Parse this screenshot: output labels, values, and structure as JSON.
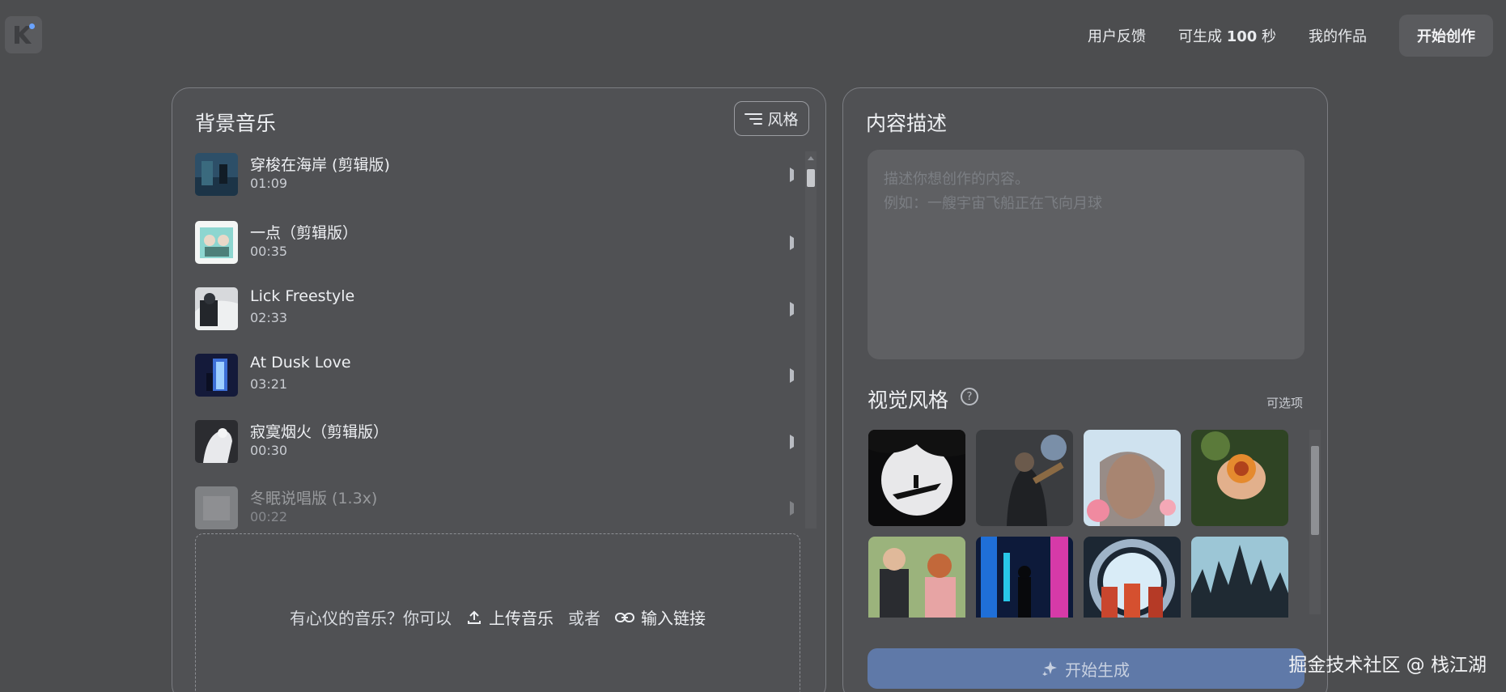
{
  "header": {
    "nav": {
      "feedback": "用户反馈",
      "credits_prefix": "可生成",
      "credits_value": "100",
      "credits_suffix": "秒",
      "my_works": "我的作品",
      "start": "开始创作"
    }
  },
  "music": {
    "title": "背景音乐",
    "style_button": "风格",
    "tracks": [
      {
        "title": "穿梭在海岸 (剪辑版)",
        "duration": "01:09"
      },
      {
        "title": "一点（剪辑版）",
        "duration": "00:35"
      },
      {
        "title": "Lick Freestyle",
        "duration": "02:33"
      },
      {
        "title": "At Dusk Love",
        "duration": "03:21"
      },
      {
        "title": "寂寞烟火（剪辑版）",
        "duration": "00:30"
      },
      {
        "title": "冬眠说唱版 (1.3x)",
        "duration": "00:22"
      }
    ],
    "upload": {
      "prompt": "有心仪的音乐？你可以",
      "upload_label": "上传音乐",
      "or": "或者",
      "link_label": "输入链接"
    }
  },
  "content": {
    "title": "内容描述",
    "placeholder": "描述你想创作的内容。\n例如：一艘宇宙飞船正在飞向月球",
    "visual_style_title": "视觉风格",
    "optional": "可选项",
    "generate": "开始生成"
  },
  "watermark": "掘金技术社区 @ 栈江湖",
  "colors": {
    "background": "#4c4d4f",
    "panel": "#505154",
    "accent_button": "#5f79a8"
  }
}
